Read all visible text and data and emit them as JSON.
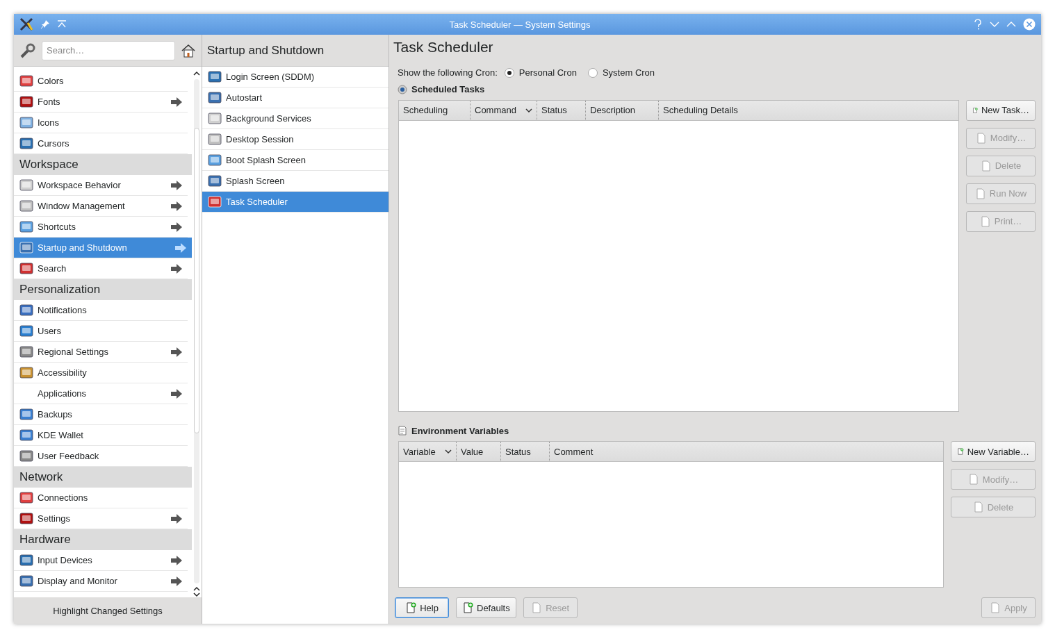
{
  "window": {
    "title": "Task Scheduler — System Settings"
  },
  "sidebar": {
    "search": {
      "placeholder": "Search…"
    },
    "items": [
      {
        "kind": "item",
        "label": "Colors",
        "icon": true,
        "arrow": false,
        "selected": false
      },
      {
        "kind": "item",
        "label": "Fonts",
        "icon": true,
        "arrow": true,
        "selected": false
      },
      {
        "kind": "item",
        "label": "Icons",
        "icon": true,
        "arrow": false,
        "selected": false
      },
      {
        "kind": "item",
        "label": "Cursors",
        "icon": true,
        "arrow": false,
        "selected": false
      },
      {
        "kind": "header",
        "label": "Workspace"
      },
      {
        "kind": "item",
        "label": "Workspace Behavior",
        "icon": true,
        "arrow": true,
        "selected": false
      },
      {
        "kind": "item",
        "label": "Window Management",
        "icon": true,
        "arrow": true,
        "selected": false
      },
      {
        "kind": "item",
        "label": "Shortcuts",
        "icon": true,
        "arrow": true,
        "selected": false
      },
      {
        "kind": "item",
        "label": "Startup and Shutdown",
        "icon": true,
        "arrow": true,
        "selected": true
      },
      {
        "kind": "item",
        "label": "Search",
        "icon": true,
        "arrow": true,
        "selected": false
      },
      {
        "kind": "header",
        "label": "Personalization"
      },
      {
        "kind": "item",
        "label": "Notifications",
        "icon": true,
        "arrow": false,
        "selected": false
      },
      {
        "kind": "item",
        "label": "Users",
        "icon": true,
        "arrow": false,
        "selected": false
      },
      {
        "kind": "item",
        "label": "Regional Settings",
        "icon": true,
        "arrow": true,
        "selected": false
      },
      {
        "kind": "item",
        "label": "Accessibility",
        "icon": true,
        "arrow": false,
        "selected": false
      },
      {
        "kind": "item",
        "label": "Applications",
        "icon": false,
        "arrow": true,
        "selected": false
      },
      {
        "kind": "item",
        "label": "Backups",
        "icon": true,
        "arrow": false,
        "selected": false
      },
      {
        "kind": "item",
        "label": "KDE Wallet",
        "icon": true,
        "arrow": false,
        "selected": false
      },
      {
        "kind": "item",
        "label": "User Feedback",
        "icon": true,
        "arrow": false,
        "selected": false
      },
      {
        "kind": "header",
        "label": "Network"
      },
      {
        "kind": "item",
        "label": "Connections",
        "icon": true,
        "arrow": false,
        "selected": false
      },
      {
        "kind": "item",
        "label": "Settings",
        "icon": true,
        "arrow": true,
        "selected": false
      },
      {
        "kind": "header",
        "label": "Hardware"
      },
      {
        "kind": "item",
        "label": "Input Devices",
        "icon": true,
        "arrow": true,
        "selected": false
      },
      {
        "kind": "item",
        "label": "Display and Monitor",
        "icon": true,
        "arrow": true,
        "selected": false
      }
    ],
    "footer": "Highlight Changed Settings"
  },
  "category": {
    "title": "Startup and Shutdown",
    "items": [
      {
        "label": "Login Screen (SDDM)",
        "selected": false
      },
      {
        "label": "Autostart",
        "selected": false
      },
      {
        "label": "Background Services",
        "selected": false
      },
      {
        "label": "Desktop Session",
        "selected": false
      },
      {
        "label": "Boot Splash Screen",
        "selected": false
      },
      {
        "label": "Splash Screen",
        "selected": false
      },
      {
        "label": "Task Scheduler",
        "selected": true
      }
    ]
  },
  "page": {
    "title": "Task Scheduler",
    "cron": {
      "label": "Show the following Cron:",
      "options": [
        {
          "label": "Personal Cron",
          "selected": true
        },
        {
          "label": "System Cron",
          "selected": false
        }
      ]
    },
    "tasks": {
      "title": "Scheduled Tasks",
      "columns": [
        {
          "label": "Scheduling",
          "sorted": false
        },
        {
          "label": "Command",
          "sorted": true
        },
        {
          "label": "Status",
          "sorted": false
        },
        {
          "label": "Description",
          "sorted": false
        },
        {
          "label": "Scheduling Details",
          "sorted": false
        }
      ],
      "buttons": [
        {
          "label": "New Task…",
          "disabled": false
        },
        {
          "label": "Modify…",
          "disabled": true
        },
        {
          "label": "Delete",
          "disabled": true
        },
        {
          "label": "Run Now",
          "disabled": true
        },
        {
          "label": "Print…",
          "disabled": true
        }
      ]
    },
    "variables": {
      "title": "Environment Variables",
      "columns": [
        {
          "label": "Variable",
          "sorted": true
        },
        {
          "label": "Value",
          "sorted": false
        },
        {
          "label": "Status",
          "sorted": false
        },
        {
          "label": "Comment",
          "sorted": false
        }
      ],
      "buttons": [
        {
          "label": "New Variable…",
          "disabled": false
        },
        {
          "label": "Modify…",
          "disabled": true
        },
        {
          "label": "Delete",
          "disabled": true
        }
      ]
    }
  },
  "footer": {
    "left_buttons": [
      {
        "label": "Help",
        "disabled": false,
        "focused": true
      },
      {
        "label": "Defaults",
        "disabled": false,
        "focused": false
      },
      {
        "label": "Reset",
        "disabled": true,
        "focused": false
      }
    ],
    "right_buttons": [
      {
        "label": "Apply",
        "disabled": true,
        "focused": false
      }
    ]
  }
}
